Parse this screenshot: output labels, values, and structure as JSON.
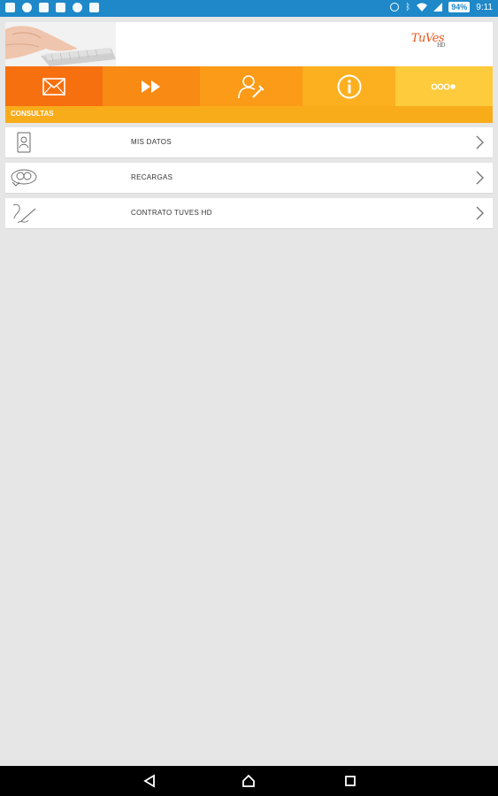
{
  "status_bar": {
    "battery": "94%",
    "time": "9:11"
  },
  "header": {
    "logo_text": "TuVes",
    "logo_sub": "HD"
  },
  "toolbar": {
    "buttons": [
      {
        "icon": "mail-icon",
        "color": "#f7700f"
      },
      {
        "icon": "fast-forward-icon",
        "color": "#f98a14"
      },
      {
        "icon": "user-settings-icon",
        "color": "#fb9b18"
      },
      {
        "icon": "info-icon",
        "color": "#fdb01f"
      },
      {
        "icon": "more-icon",
        "color": "#fdcb3b"
      }
    ]
  },
  "section": {
    "title": "CONSULTAS"
  },
  "menu": {
    "items": [
      {
        "label": "MIS DATOS",
        "icon": "id-card-icon"
      },
      {
        "label": "RECARGAS",
        "icon": "recharge-icon"
      },
      {
        "label": "CONTRATO TUVES HD",
        "icon": "contract-signature-icon"
      }
    ]
  },
  "colors": {
    "status_bar": "#1e88c8",
    "accent_orange": "#f7700f",
    "section_bar": "#f9ac1a"
  }
}
